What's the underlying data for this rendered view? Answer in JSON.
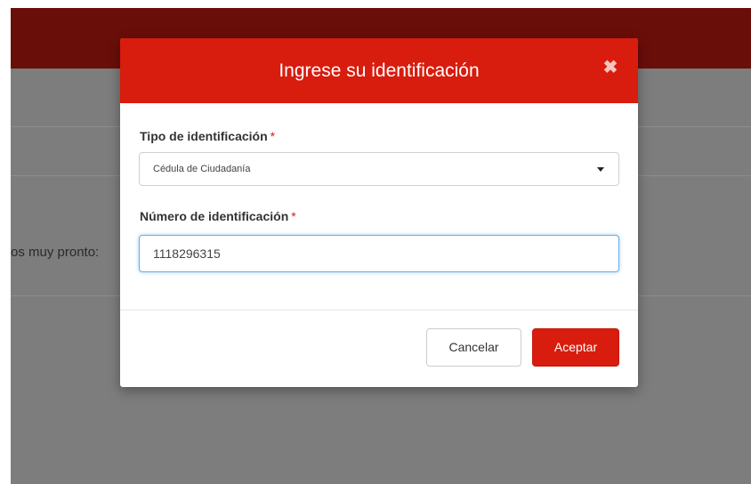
{
  "background": {
    "partial_text": "os muy pronto:"
  },
  "modal": {
    "title": "Ingrese su identificación",
    "close_icon": "close-icon",
    "id_type": {
      "label": "Tipo de identificación",
      "required_mark": "*",
      "selected_value": "Cédula de Ciudadanía"
    },
    "id_number": {
      "label": "Número de identificación",
      "required_mark": "*",
      "value": "1118296315"
    },
    "buttons": {
      "cancel": "Cancelar",
      "accept": "Aceptar"
    }
  },
  "colors": {
    "accent": "#d81c0e",
    "topbar": "#6a0e09",
    "overlay": "#7d7d7d",
    "focus": "#66afe9"
  }
}
